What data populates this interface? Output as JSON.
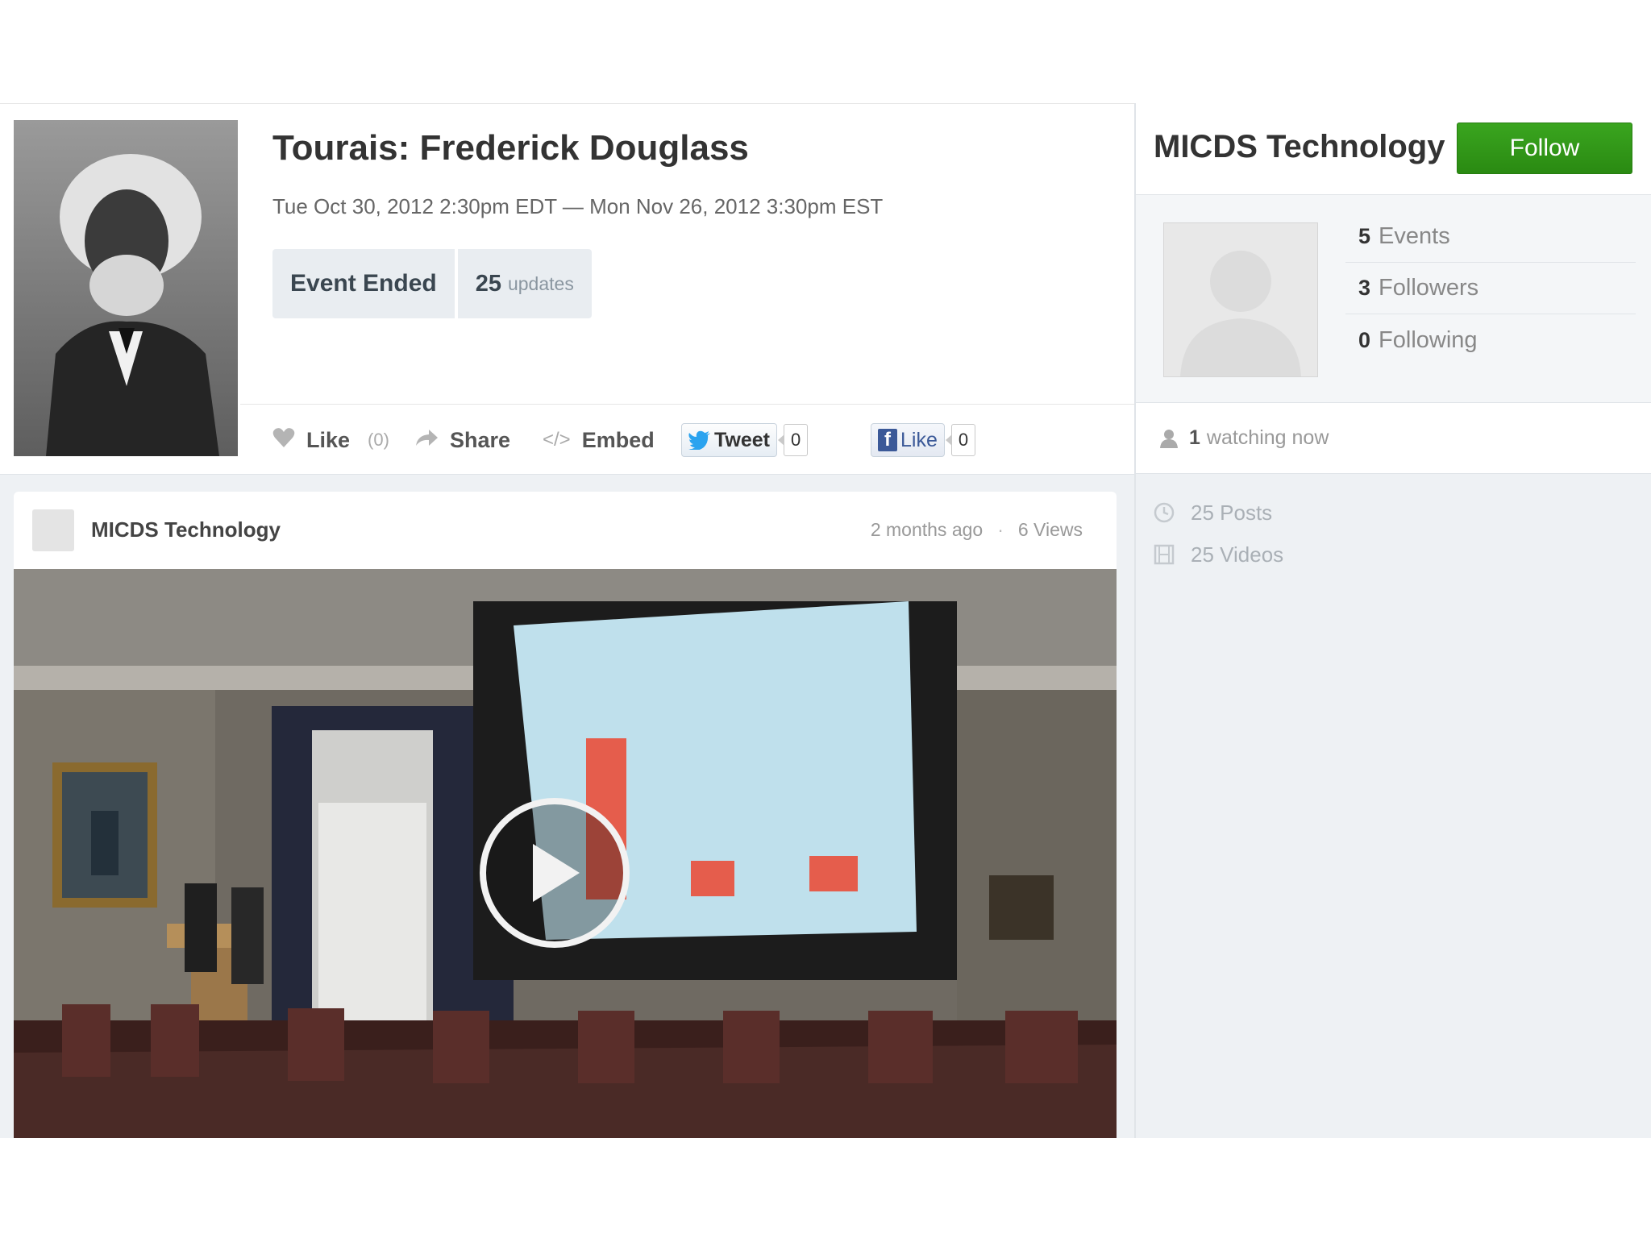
{
  "event": {
    "title": "Tourais: Frederick Douglass",
    "dates": "Tue Oct 30, 2012 2:30pm EDT — Mon Nov 26, 2012 3:30pm EST",
    "status": "Event Ended",
    "updates_count": "25",
    "updates_label": "updates"
  },
  "actions": {
    "like_label": "Like",
    "like_count": "(0)",
    "share_label": "Share",
    "embed_label": "Embed",
    "tweet_label": "Tweet",
    "tweet_count": "0",
    "fb_like_label": "Like",
    "fb_like_count": "0"
  },
  "post": {
    "author": "MICDS Technology",
    "time": "2 months ago",
    "separator": "·",
    "views": "6 Views"
  },
  "sidebar": {
    "title": "MICDS Technology",
    "follow_label": "Follow",
    "stats": [
      {
        "count": "5",
        "label": "Events"
      },
      {
        "count": "3",
        "label": "Followers"
      },
      {
        "count": "0",
        "label": "Following"
      }
    ],
    "watching_count": "1",
    "watching_label": "watching now",
    "posts_label": "25 Posts",
    "videos_label": "25 Videos"
  },
  "icons": {
    "like": "heart-icon",
    "share": "arrow-right-icon",
    "embed": "code-icon",
    "tweet": "twitter-bird-icon",
    "fb": "facebook-f-icon",
    "watch": "person-icon",
    "posts": "clock-icon",
    "videos": "film-icon",
    "play": "play-icon"
  },
  "colors": {
    "follow": "#2f9616",
    "gray_bg": "#eef1f4",
    "status_bg": "#e9edf1",
    "facebook": "#3b5998",
    "twitter": "#1da1f2"
  }
}
